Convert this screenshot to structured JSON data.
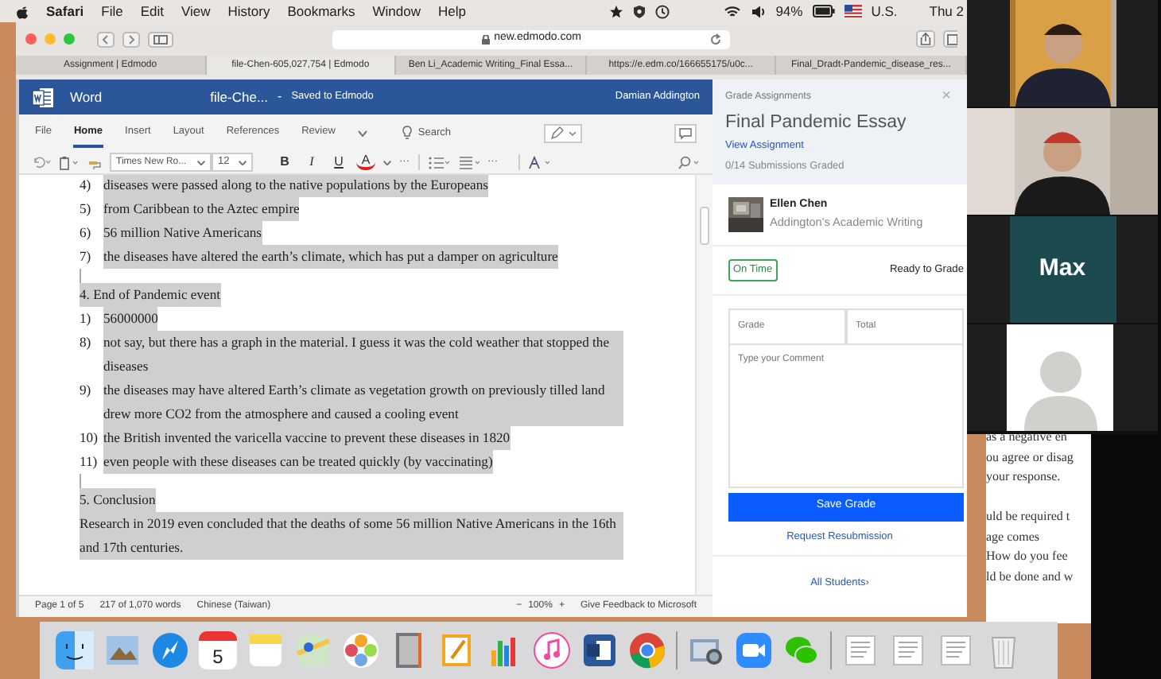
{
  "menu_bar": {
    "app": "Safari",
    "menus": [
      "File",
      "Edit",
      "View",
      "History",
      "Bookmarks",
      "Window",
      "Help"
    ],
    "battery": "94%",
    "input_source": "U.S.",
    "clock": "Thu 2"
  },
  "browser": {
    "url": "new.edmodo.com",
    "tabs": [
      {
        "label": "Assignment | Edmodo",
        "selected": false
      },
      {
        "label": "file-Chen-605,027,754 | Edmodo",
        "selected": true
      },
      {
        "label": "Ben Li_Academic Writing_Final Essa...",
        "selected": false
      },
      {
        "label": "https://e.edm.co/166655175/u0c...",
        "selected": false
      },
      {
        "label": "Final_Dradt-Pandemic_disease_res...",
        "selected": false
      }
    ]
  },
  "word": {
    "app_name": "Word",
    "doc_title": "file-Che...",
    "separator": "-",
    "save_status": "Saved to Edmodo",
    "user": "Damian Addington",
    "ribbon_tabs": [
      {
        "label": "File",
        "selected": false
      },
      {
        "label": "Home",
        "selected": true
      },
      {
        "label": "Insert",
        "selected": false
      },
      {
        "label": "Layout",
        "selected": false
      },
      {
        "label": "References",
        "selected": false
      },
      {
        "label": "Review",
        "selected": false
      }
    ],
    "search": "Search",
    "font": "Times New Ro...",
    "font_size": "12",
    "format_buttons": [
      "B",
      "I",
      "U",
      "A"
    ],
    "more": "···",
    "more_2": "···",
    "document": [
      {
        "kind": "item",
        "number": "4)",
        "text": "diseases were passed along to the native populations by the Europeans",
        "highlighted": true
      },
      {
        "kind": "item",
        "number": "5)",
        "text": "from Caribbean to the Aztec empire",
        "highlighted": true
      },
      {
        "kind": "item",
        "number": "6)",
        "text": "56 million Native Americans",
        "highlighted": true
      },
      {
        "kind": "item",
        "number": "7)",
        "text": "the diseases have altered the earth’s climate, which has put a damper on agriculture",
        "highlighted": true
      },
      {
        "kind": "blank",
        "highlighted": true
      },
      {
        "kind": "paragraph",
        "text": "4. End of Pandemic event",
        "highlighted": true
      },
      {
        "kind": "item",
        "number": "1)",
        "text": "56000000",
        "highlighted": true
      },
      {
        "kind": "item",
        "number": "8)",
        "text": "not say, but there has a graph in the material. I guess it was the cold weather that stopped the diseases",
        "highlighted": true
      },
      {
        "kind": "item",
        "number": "9)",
        "text": "the diseases may have altered Earth’s climate as vegetation growth on previously tilled land drew more CO2 from the atmosphere and caused a cooling event",
        "highlighted": true
      },
      {
        "kind": "item",
        "number": "10)",
        "text": "the British invented the varicella vaccine to prevent these diseases in 1820",
        "highlighted": true
      },
      {
        "kind": "item",
        "number": "11)",
        "text": "even people with these diseases can be treated quickly (by vaccinating)",
        "highlighted": true
      },
      {
        "kind": "blank",
        "highlighted": true
      },
      {
        "kind": "paragraph",
        "text": "5. Conclusion",
        "highlighted": true
      },
      {
        "kind": "paragraph",
        "text": "Research in 2019 even concluded that the deaths of some 56 million Native Americans in the 16th and 17th centuries.",
        "highlighted": true
      }
    ],
    "status_bar": {
      "page": "Page 1 of 5",
      "words": "217 of 1,070 words",
      "language": "Chinese (Taiwan)",
      "zoom_out": "−",
      "zoom": "100%",
      "zoom_in": "+",
      "feedback": "Give Feedback to Microsoft"
    }
  },
  "grading_panel": {
    "header": "Grade Assignments",
    "close": "×",
    "assignment": "Final Pandemic Essay",
    "view_link": "View Assignment",
    "progress": "0/14 Submissions Graded",
    "student": {
      "name": "Ellen Chen",
      "course": "Addington's Academic Writing"
    },
    "status_tag": "On Time",
    "status": "Ready to Grade",
    "grade_placeholder": "Grade",
    "total_placeholder": "Total",
    "comment_placeholder": "Type your Comment",
    "save_button": "Save Grade",
    "resubmit_link": "Request Resubmission",
    "all_students_link": "All Students›"
  },
  "background_document": {
    "paragraphs": [
      [
        "as a negative en",
        "ou agree or disag",
        "your response."
      ],
      [
        "uld be required t",
        "age comes",
        "How do you fee",
        "ld be done and w"
      ]
    ]
  },
  "participants": [
    {
      "kind": "video"
    },
    {
      "kind": "video"
    },
    {
      "kind": "name",
      "name": "Max"
    },
    {
      "kind": "avatar"
    }
  ],
  "dock": {
    "calendar_day": "5",
    "items": [
      {
        "kind": "finder"
      },
      {
        "kind": "preview"
      },
      {
        "kind": "safari"
      },
      {
        "kind": "calendar"
      },
      {
        "kind": "notes"
      },
      {
        "kind": "maps"
      },
      {
        "kind": "photos"
      },
      {
        "kind": "notebook"
      },
      {
        "kind": "pages"
      },
      {
        "kind": "numbers"
      },
      {
        "kind": "music"
      },
      {
        "kind": "word"
      },
      {
        "kind": "chrome"
      },
      {
        "kind": "separator"
      },
      {
        "kind": "image-capture"
      },
      {
        "kind": "zoom"
      },
      {
        "kind": "wechat"
      },
      {
        "kind": "separator"
      },
      {
        "kind": "document"
      },
      {
        "kind": "document"
      },
      {
        "kind": "document"
      },
      {
        "kind": "trash"
      }
    ]
  }
}
